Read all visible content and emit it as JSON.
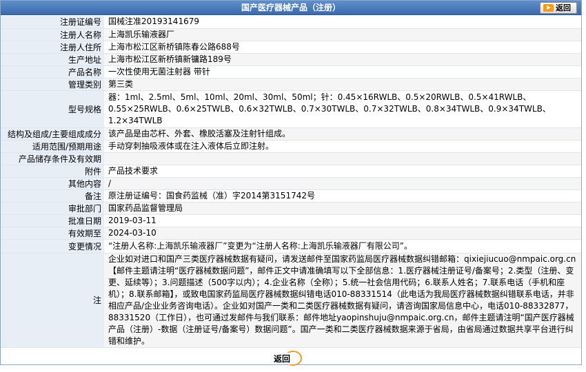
{
  "title": "国产医疗器械产品（注册）",
  "back_label": "返回",
  "fields": {
    "reg_no": {
      "label": "注册证编号",
      "value": "国械注准20193141679"
    },
    "registrant": {
      "label": "注册人名称",
      "value": "上海凯乐输液器厂"
    },
    "registrant_address": {
      "label": "注册人住所",
      "value": "上海市松江区新桥镇陈春公路688号"
    },
    "production_address": {
      "label": "生产地址",
      "value": "上海市松江区新桥镇新镛路189号"
    },
    "product_name": {
      "label": "产品名称",
      "value": "一次性使用无菌注射器 带针"
    },
    "category": {
      "label": "管理类别",
      "value": "第三类"
    },
    "models": {
      "label": "型号规格",
      "value": "器：1ml、2.5ml、5ml、10ml、20ml、30ml、50ml；针：0.45×16RWLB、0.5×20RWLB、0.5×41RWLB、0.55×25RWLB、0.6×25TWLB、0.6×32TWLB、0.7×30TWLB、0.7×32TWLB、0.8×34TWLB、0.9×34TWLB、1.2×34TWLB"
    },
    "structure": {
      "label": "结构及组成/主要组成成分",
      "value": "该产品是由芯杆、外套、橡胶活塞及注射针组成。"
    },
    "scope": {
      "label": "适用范围/预期用途",
      "value": "手动穿刺抽吸液体或在注入液体后立即注射。"
    },
    "storage": {
      "label": "产品储存条件及有效期",
      "value": ""
    },
    "attachment": {
      "label": "附件",
      "value": "产品技术要求"
    },
    "other": {
      "label": "其他内容",
      "value": "/"
    },
    "remark": {
      "label": "备注",
      "value": "原注册证编号：国食药监械（准）字2014第3151742号"
    },
    "approval_dept": {
      "label": "审批部门",
      "value": "国家药品监督管理局"
    },
    "approval_date": {
      "label": "批准日期",
      "value": "2019-03-11"
    },
    "valid_until": {
      "label": "有效期至",
      "value": "2024-03-10"
    },
    "changes": {
      "label": "变更情况",
      "value": "“注册人名称:上海凯乐输液器厂”变更为“注册人名称:上海凯乐输液器厂有限公司”。"
    },
    "note": {
      "label": "注",
      "value": "企业如对进口和国产三类医疗器械数据有疑问，请发送邮件至国家药监局医疗器械数据纠错邮箱：qixiejiucuo@nmpaic.org.cn【邮件主题请注明“医疗器械数据问题”，邮件正文中请准确填写以下全部信息：1.医疗器械注册证号/备案号；2.类型（注册、变更、延续等）；3.问题描述（500字以内）；4.企业名称（全称）；5.统一社会信用代码；6.联系人姓名；7.联系电话（手机和座机）；8.联系邮箱】，或致电国家药监局医疗器械数据纠错电话010-88331514（此电话为我局医疗器械数据纠错联系电话，并非相应产品/企业业务咨询电话）。企业如对国产一类和二类医疗器械数据有疑问，请咨询国家局信息中心，电话010-88332877，88331520（工作日），也可通过发邮件与我们联系：邮件地址yaopinshuju@nmpaic.org.cn，邮件主题请注明“国产医疗器械产品（注册）-数据（注册证号/备案号）数据问题”。国产一类和二类医疗器械数据来源于省局，由省局通过数据共享平台进行纠错和维护。"
    }
  },
  "colors": {
    "title_bar": "#3b6aac",
    "label_bg": "#e8eef6",
    "accent_orange": "#f39a1e"
  }
}
